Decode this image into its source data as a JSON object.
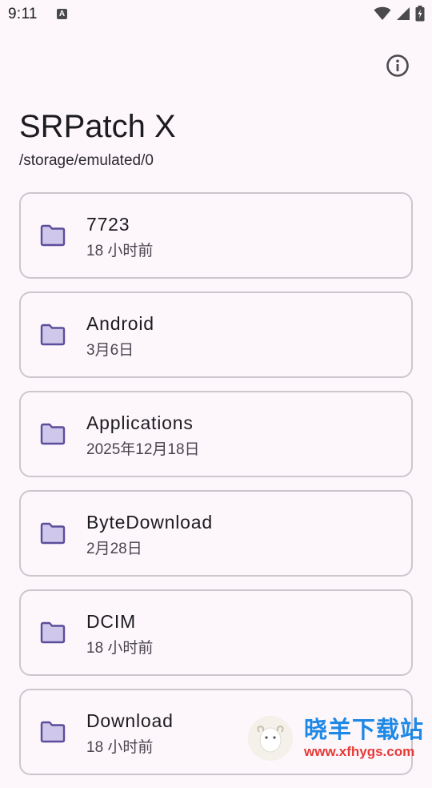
{
  "status_bar": {
    "time": "9:11",
    "notification_icon": "a-icon",
    "wifi_icon": "wifi-icon",
    "signal_icon": "signal-icon",
    "battery_icon": "battery-charging-icon"
  },
  "header": {
    "title": "SRPatch X",
    "path": "/storage/emulated/0",
    "info_icon": "info-icon"
  },
  "files": [
    {
      "name": "7723",
      "date": "18 小时前",
      "icon": "folder-icon"
    },
    {
      "name": "Android",
      "date": "3月6日",
      "icon": "folder-icon"
    },
    {
      "name": "Applications",
      "date": "2025年12月18日",
      "icon": "folder-icon"
    },
    {
      "name": "ByteDownload",
      "date": "2月28日",
      "icon": "folder-icon"
    },
    {
      "name": "DCIM",
      "date": "18 小时前",
      "icon": "folder-icon"
    },
    {
      "name": "Download",
      "date": "18 小时前",
      "icon": "folder-icon"
    }
  ],
  "watermark": {
    "name": "晓羊下载站",
    "url": "www.xfhygs.com"
  },
  "colors": {
    "background": "#fdf7fc",
    "card_border": "#cdc6ce",
    "folder_fill": "#d0c8ea",
    "folder_stroke": "#5b4d9a",
    "watermark_blue": "#1e88e5",
    "watermark_red": "#e53935"
  }
}
